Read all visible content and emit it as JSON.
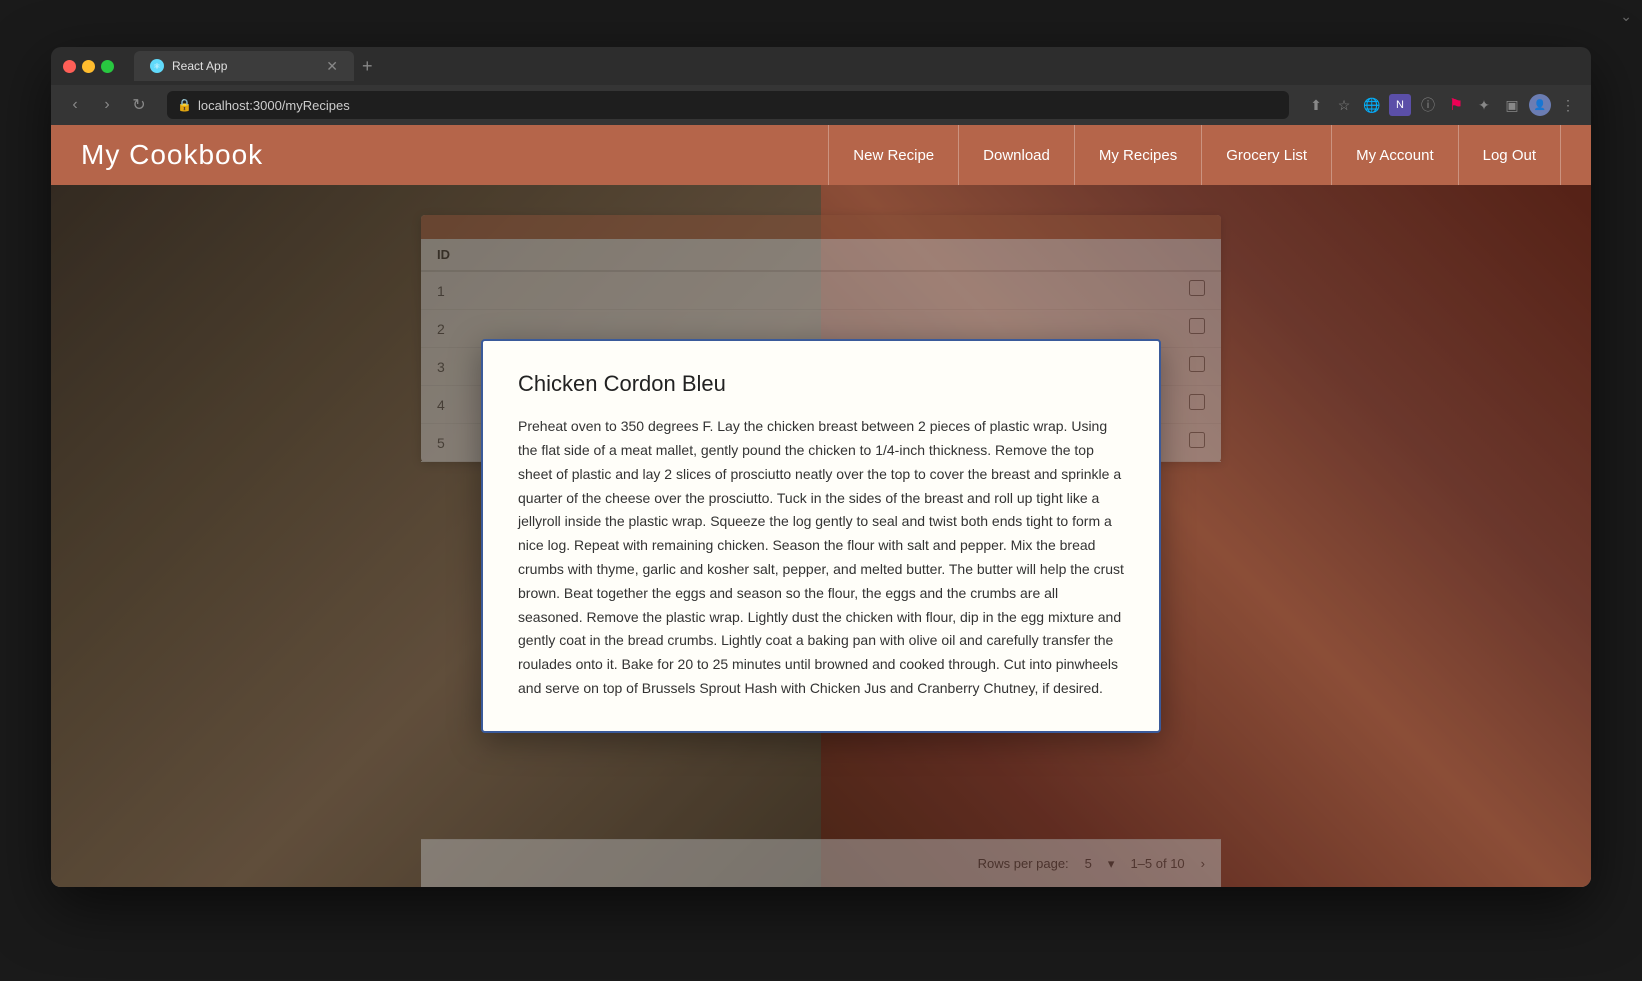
{
  "browser": {
    "tab_title": "React App",
    "url": "localhost:3000/myRecipes",
    "favicon": "⚛"
  },
  "navbar": {
    "logo": "My Cookbook",
    "links": [
      {
        "label": "New Recipe",
        "id": "new-recipe"
      },
      {
        "label": "Download",
        "id": "download"
      },
      {
        "label": "My Recipes",
        "id": "my-recipes"
      },
      {
        "label": "Grocery List",
        "id": "grocery-list"
      },
      {
        "label": "My Account",
        "id": "my-account"
      },
      {
        "label": "Log Out",
        "id": "log-out"
      }
    ]
  },
  "table": {
    "header_color": "#c1714f",
    "col_id": "ID",
    "rows": [
      {
        "id": "1"
      },
      {
        "id": "2"
      },
      {
        "id": "3"
      },
      {
        "id": "4"
      },
      {
        "id": "5"
      }
    ],
    "pagination": {
      "rows_per_page_label": "Rows per page:",
      "rows_per_page_value": "5",
      "range": "1–5 of 10"
    }
  },
  "modal": {
    "title": "Chicken Cordon Bleu",
    "body": "Preheat oven to 350 degrees F. Lay the chicken breast between 2 pieces of plastic wrap. Using the flat side of a meat mallet, gently pound the chicken to 1/4-inch thickness. Remove the top sheet of plastic and lay 2 slices of prosciutto neatly over the top to cover the breast and sprinkle a quarter of the cheese over the prosciutto. Tuck in the sides of the breast and roll up tight like a jellyroll inside the plastic wrap. Squeeze the log gently to seal and twist both ends tight to form a nice log. Repeat with remaining chicken. Season the flour with salt and pepper. Mix the bread crumbs with thyme, garlic and kosher salt, pepper, and melted butter. The butter will help the crust brown. Beat together the eggs and season so the flour, the eggs and the crumbs are all seasoned. Remove the plastic wrap. Lightly dust the chicken with flour, dip in the egg mixture and gently coat in the bread crumbs. Lightly coat a baking pan with olive oil and carefully transfer the roulades onto it. Bake for 20 to 25 minutes until browned and cooked through. Cut into pinwheels and serve on top of Brussels Sprout Hash with Chicken Jus and Cranberry Chutney, if desired."
  }
}
